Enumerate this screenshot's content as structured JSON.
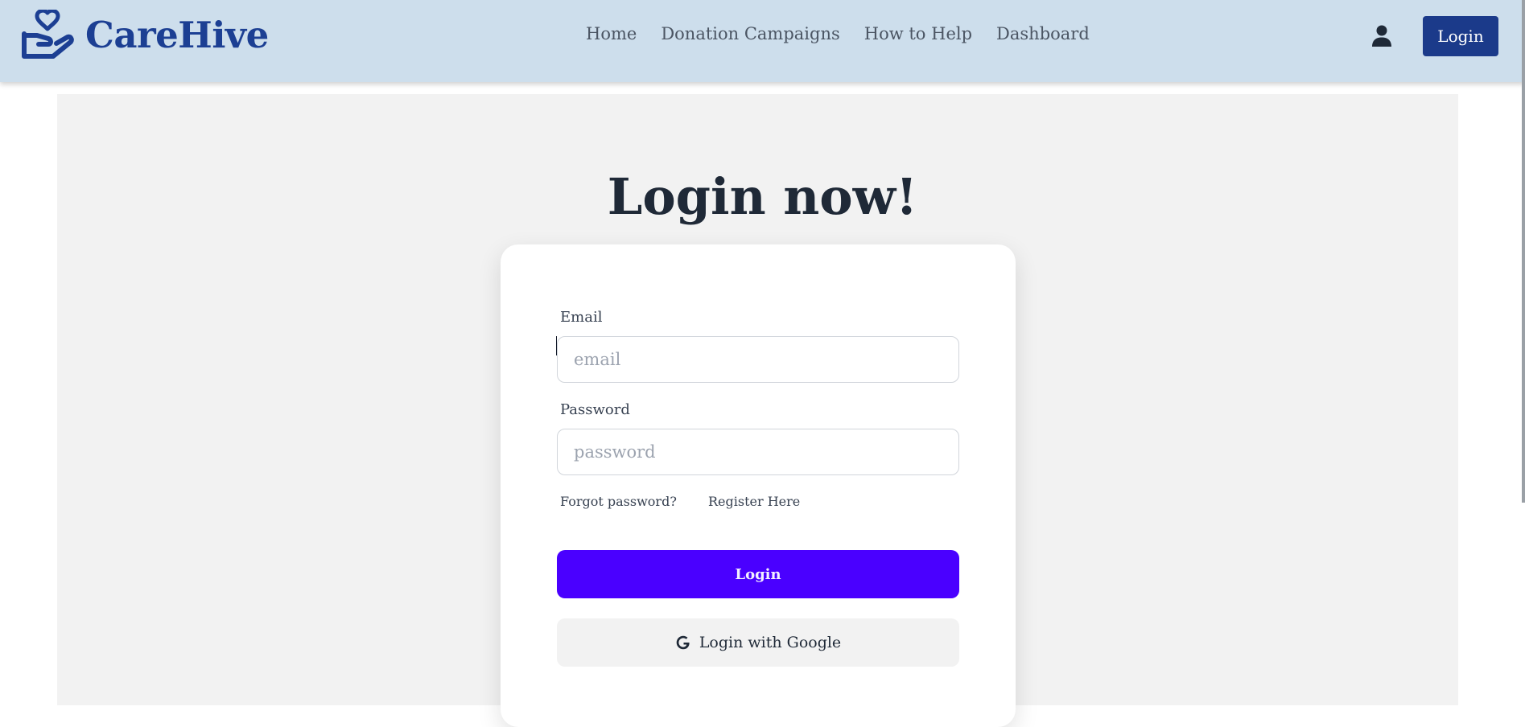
{
  "brand": {
    "name": "CareHive",
    "logo_icon": "heart-in-hand-icon"
  },
  "nav": {
    "links": [
      "Home",
      "Donation Campaigns",
      "How to Help",
      "Dashboard"
    ],
    "user_icon": "user-icon",
    "login_label": "Login"
  },
  "page": {
    "title": "Login now!"
  },
  "form": {
    "email_label": "Email",
    "email_placeholder": "email",
    "email_value": "",
    "password_label": "Password",
    "password_placeholder": "password",
    "password_value": "",
    "forgot_link": "Forgot password?",
    "register_link": "Register Here",
    "submit_label": "Login",
    "google_label": "Login with Google",
    "google_icon": "google-icon"
  },
  "colors": {
    "navbar_bg": "#cddeec",
    "brand": "#1c3f93",
    "nav_login_bg": "#1b3a8a",
    "primary_button": "#4a00ff",
    "panel_bg": "#f2f2f2"
  }
}
